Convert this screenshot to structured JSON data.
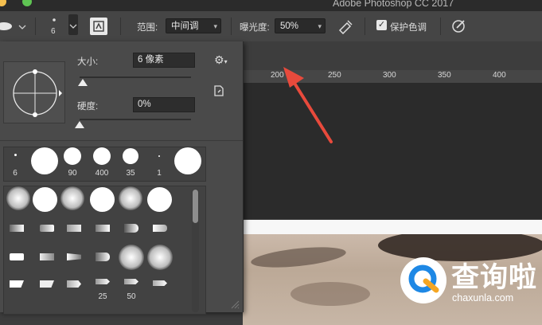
{
  "app": {
    "title": "Adobe Photoshop CC 2017"
  },
  "window_controls": {
    "yellow": "#f5bf4f",
    "green": "#5fc453"
  },
  "options_bar": {
    "brush_size_badge": "6",
    "range_label": "范围:",
    "range_value": "中间调",
    "exposure_label": "曝光度:",
    "exposure_value": "50%",
    "protect_tones_label": "保护色调",
    "protect_tones_checked": true,
    "icons": [
      "dodge-tool-icon",
      "brush-preset-icon",
      "toggle-brush-panel-icon",
      "airbrush-icon",
      "pressure-size-icon"
    ]
  },
  "brush_panel": {
    "size_label": "大小:",
    "size_value": "6 像素",
    "size_slider_fraction": 0.03,
    "hardness_label": "硬度:",
    "hardness_value": "0%",
    "hardness_slider_fraction": 0.0,
    "recent_brushes": [
      {
        "kind": "dot",
        "label": "6"
      },
      {
        "kind": "hard",
        "label": ""
      },
      {
        "kind": "hard",
        "label": "90"
      },
      {
        "kind": "hard",
        "label": "400"
      },
      {
        "kind": "hard",
        "label": "35"
      },
      {
        "kind": "dot",
        "label": "1"
      },
      {
        "kind": "hard",
        "label": ""
      }
    ],
    "grid_labels": [
      "25",
      "50"
    ],
    "icons": [
      "gear-icon",
      "new-preset-icon",
      "brush-angle-preview-icon"
    ]
  },
  "ruler": {
    "labels": [
      "200",
      "250",
      "300",
      "350",
      "400"
    ]
  },
  "annotation": {
    "arrow_color": "#e84a3c"
  },
  "watermark": {
    "brand_text": "查询啦",
    "url_text": "chaxunla.com",
    "badge_color": "#1e88e5"
  }
}
